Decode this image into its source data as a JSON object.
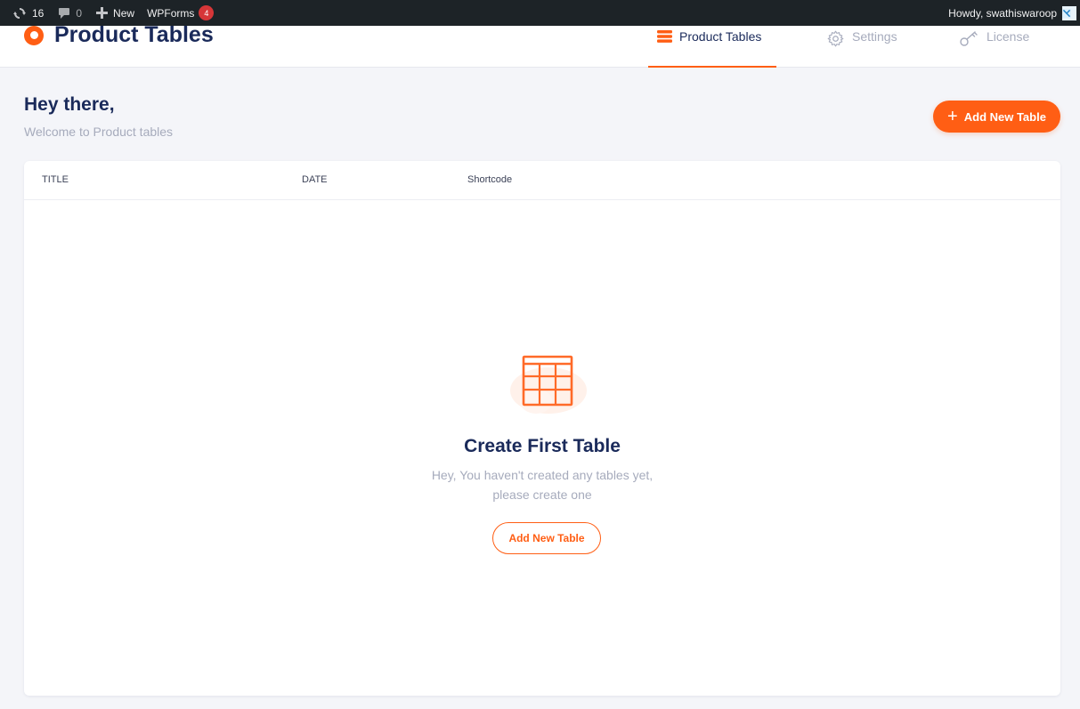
{
  "adminbar": {
    "updates_count": "16",
    "comments_count": "0",
    "new_label": "New",
    "wpforms_label": "WPForms",
    "wpforms_badge": "4",
    "greeting": "Howdy, swathiswaroop"
  },
  "header": {
    "brand_title": "Product Tables",
    "tabs": [
      {
        "label": "Product Tables",
        "icon": "stack-icon",
        "active": true
      },
      {
        "label": "Settings",
        "icon": "gear-icon",
        "active": false
      },
      {
        "label": "License",
        "icon": "key-icon",
        "active": false
      }
    ]
  },
  "greeting": {
    "title": "Hey there,",
    "subtitle": "Welcome to Product tables"
  },
  "toolbar": {
    "add_new_label": "Add New Table"
  },
  "table": {
    "columns": [
      "TITLE",
      "DATE",
      "Shortcode"
    ],
    "rows": []
  },
  "empty_state": {
    "title": "Create First Table",
    "description_line1": "Hey, You haven't created any tables yet,",
    "description_line2": "please create one",
    "button_label": "Add New Table"
  },
  "colors": {
    "accent": "#ff5e14",
    "heading": "#1a2a5a",
    "muted": "#a6abbc",
    "adminbar_bg": "#1d2327"
  }
}
